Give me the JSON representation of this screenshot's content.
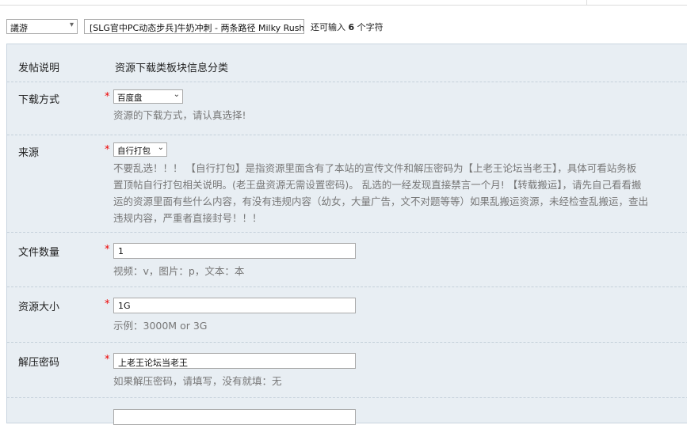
{
  "title_row": {
    "category": "議游",
    "title": "[SLG官中PC动态步兵]牛奶冲刺 - 两条路径 Milky Rush-Tv",
    "remain_prefix": "还可输入",
    "remain_count": "6",
    "remain_suffix": "个字符"
  },
  "post_desc": {
    "label": "发帖说明",
    "value": "资源下载类板块信息分类"
  },
  "download": {
    "label": "下载方式",
    "star": "*",
    "selected": "百度盘",
    "hint": "资源的下载方式，请认真选择!"
  },
  "source": {
    "label": "来源",
    "star": "*",
    "selected": "自行打包",
    "hint_lines": [
      "不要乱选！！！ 【自行打包】是指资源里面含有了本站的宣传文件和解压密码为【上老王论坛当老王】，具体可看站务板",
      "置顶帖自行打包相关说明。(老王盘资源无需设置密码)。 乱选的一经发现直接禁言一个月! 【转载搬运】，请先自己看看搬",
      "运的资源里面有些什么内容，有没有违规内容（幼女，大量广告，文不对题等等）如果乱搬运资源，未经检查乱搬运，查出",
      "违规内容，严重者直接封号！！！"
    ]
  },
  "file_count": {
    "label": "文件数量",
    "star": "*",
    "value": "1",
    "hint": "视频：v，图片：p，文本：本"
  },
  "size": {
    "label": "资源大小",
    "star": "*",
    "value": "1G",
    "hint": "示例：3000M or 3G"
  },
  "password": {
    "label": "解压密码",
    "star": "*",
    "value": "上老王论坛当老王",
    "hint": "如果解压密码，请填写，没有就填：无"
  }
}
